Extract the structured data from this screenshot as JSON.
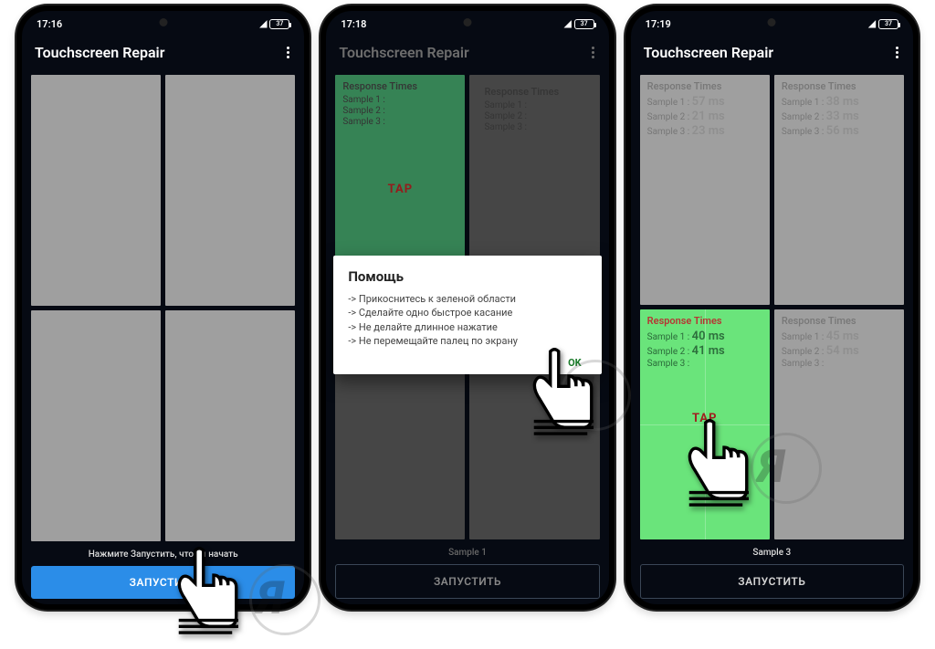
{
  "phones": [
    {
      "time": "17:16",
      "battery": "37",
      "title": "Touchscreen Repair",
      "hint": "Нажмите Запустить, чтобы начать",
      "button": "ЗАПУСТИТЬ"
    },
    {
      "time": "17:18",
      "battery": "37",
      "title": "Touchscreen Repair",
      "tap": "TAP",
      "panel_title": "Response Times",
      "s1": "Sample 1 :",
      "s2": "Sample 2 :",
      "s3": "Sample 3 :",
      "dialog": {
        "title": "Помощь",
        "l1": "-> Прикоснитесь к зеленой области",
        "l2": "-> Сделайте одно быстрое касание",
        "l3": "-> Не делайте длинное нажатие",
        "l4": "-> Не перемещайте палец по экрану",
        "ok": "OK"
      },
      "hint": "Sample 1",
      "button": "ЗАПУСТИТЬ"
    },
    {
      "time": "17:19",
      "battery": "37",
      "title": "Touchscreen Repair",
      "tap": "TAP",
      "panels": {
        "tl": {
          "title": "Response Times",
          "s1l": "Sample 1 :",
          "s1v": "57 ms",
          "s2l": "Sample 2 :",
          "s2v": "21 ms",
          "s3l": "Sample 3 :",
          "s3v": "23 ms"
        },
        "tr": {
          "title": "Response Times",
          "s1l": "Sample 1 :",
          "s1v": "38 ms",
          "s2l": "Sample 2 :",
          "s2v": "33 ms",
          "s3l": "Sample 3 :",
          "s3v": "56 ms"
        },
        "bl": {
          "title": "Response Times",
          "s1l": "Sample 1 :",
          "s1v": "40 ms",
          "s2l": "Sample 2 :",
          "s2v": "41 ms",
          "s3l": "Sample 3 :",
          "s3v": ""
        },
        "br": {
          "title": "Response Times",
          "s1l": "Sample 1 :",
          "s1v": "45 ms",
          "s2l": "Sample 2 :",
          "s2v": "54 ms",
          "s3l": "Sample 3 :",
          "s3v": ""
        }
      },
      "hint": "Sample 3",
      "button": "ЗАПУСТИТЬ"
    }
  ]
}
